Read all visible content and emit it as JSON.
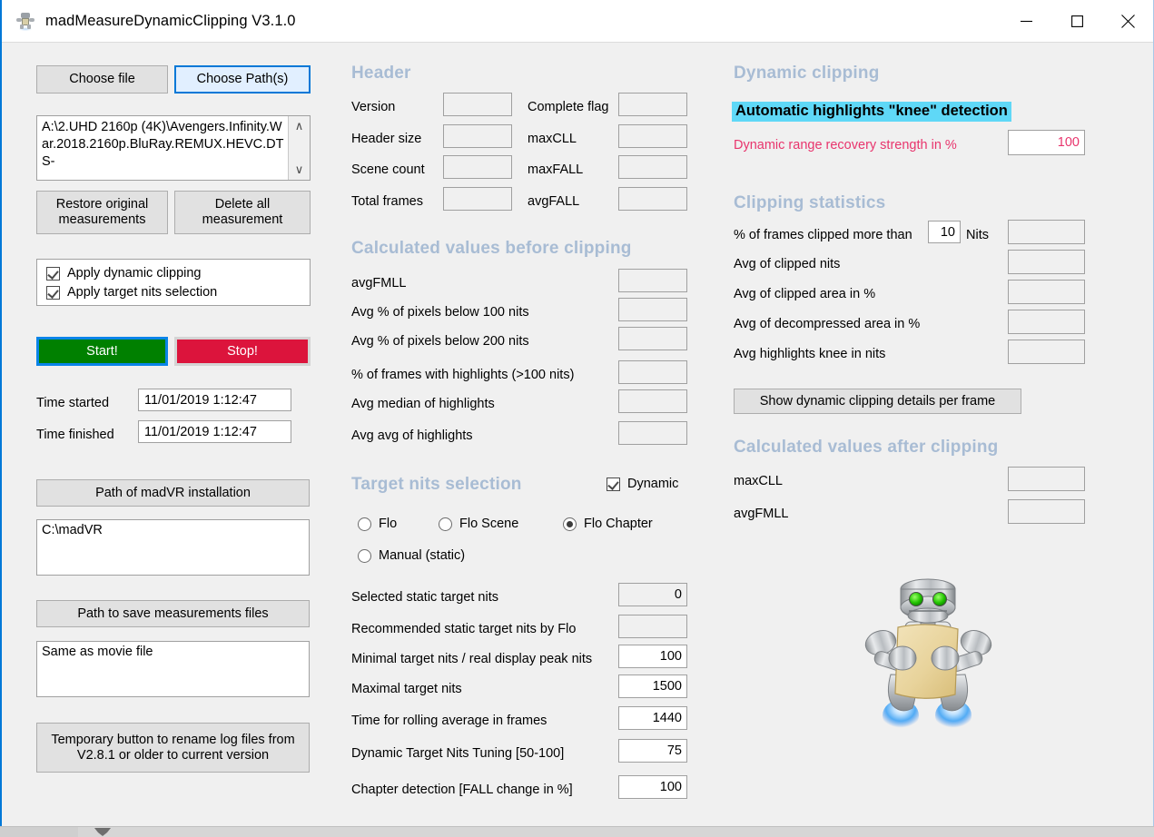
{
  "window": {
    "title": "madMeasureDynamicClipping V3.1.0",
    "icon": "robot-icon",
    "minimize_label": "minimize-icon",
    "maximize_label": "maximize-icon",
    "close_label": "close-icon"
  },
  "left": {
    "choose_file_button": "Choose file",
    "choose_paths_button": "Choose Path(s)",
    "file_path": "A:\\2.UHD 2160p (4K)\\Avengers.Infinity.War.2018.2160p.BluRay.REMUX.HEVC.DTS-",
    "scroll_up": "∧",
    "scroll_down": "∨",
    "restore_button": "Restore original measurements",
    "delete_button": "Delete all measurement",
    "checkboxes": [
      {
        "label": "Apply dynamic clipping",
        "checked": true
      },
      {
        "label": "Apply target nits selection",
        "checked": true
      }
    ],
    "start_button": "Start!",
    "stop_button": "Stop!",
    "time_started_label": "Time started",
    "time_started_value": "11/01/2019 1:12:47",
    "time_finished_label": "Time finished",
    "time_finished_value": "11/01/2019 1:12:47",
    "madvr_path_button": "Path of madVR installation",
    "madvr_path_value": "C:\\madVR",
    "save_path_button": "Path to save measurements files",
    "save_path_value": "Same as movie file",
    "rename_button": "Temporary button to rename log files from V2.8.1 or older to current version"
  },
  "header": {
    "section_title": "Header",
    "fields_left": [
      {
        "label": "Version",
        "value": ""
      },
      {
        "label": "Header size",
        "value": ""
      },
      {
        "label": "Scene count",
        "value": ""
      },
      {
        "label": "Total frames",
        "value": ""
      }
    ],
    "fields_right": [
      {
        "label": "Complete flag",
        "value": ""
      },
      {
        "label": "maxCLL",
        "value": ""
      },
      {
        "label": "maxFALL",
        "value": ""
      },
      {
        "label": "avgFALL",
        "value": ""
      }
    ]
  },
  "before_clipping": {
    "section_title": "Calculated values before clipping",
    "rows": [
      {
        "label": "avgFMLL",
        "value": ""
      },
      {
        "label": "Avg % of pixels below 100 nits",
        "value": ""
      },
      {
        "label": "Avg % of pixels below 200 nits",
        "value": ""
      },
      {
        "label": "% of frames with highlights (>100 nits)",
        "value": ""
      },
      {
        "label": "Avg median of highlights",
        "value": ""
      },
      {
        "label": "Avg avg of highlights",
        "value": ""
      }
    ]
  },
  "target_nits": {
    "section_title": "Target nits selection",
    "dynamic_checkbox": {
      "label": "Dynamic",
      "checked": true
    },
    "radios": [
      {
        "label": "Flo",
        "selected": false
      },
      {
        "label": "Flo Scene",
        "selected": false
      },
      {
        "label": "Flo Chapter",
        "selected": true
      },
      {
        "label": "Manual (static)",
        "selected": false
      }
    ],
    "rows": [
      {
        "label": "Selected static target nits",
        "value": "0",
        "editable": false
      },
      {
        "label": "Recommended static target nits by Flo",
        "value": "",
        "editable": false
      },
      {
        "label": "Minimal target nits / real display peak nits",
        "value": "100",
        "editable": true
      },
      {
        "label": "Maximal target nits",
        "value": "1500",
        "editable": true
      },
      {
        "label": "Time for rolling average in frames",
        "value": "1440",
        "editable": true
      },
      {
        "label": "Dynamic Target Nits Tuning [50-100]",
        "value": "75",
        "editable": true
      },
      {
        "label": "Chapter detection [FALL change in %]",
        "value": "100",
        "editable": true
      }
    ]
  },
  "dynamic_clipping": {
    "section_title": "Dynamic clipping",
    "knee_banner": "Automatic highlights \"knee\" detection",
    "strength_label": "Dynamic range recovery strength in %",
    "strength_value": "100"
  },
  "clipping_stats": {
    "section_title": "Clipping statistics",
    "frames_clipped_label_a": "% of frames clipped more than",
    "frames_clipped_threshold": "10",
    "frames_clipped_label_b": "Nits",
    "frames_clipped_value": "",
    "rows": [
      {
        "label": "Avg of clipped nits",
        "value": ""
      },
      {
        "label": "Avg of clipped area in %",
        "value": ""
      },
      {
        "label": "Avg of decompressed area in %",
        "value": ""
      },
      {
        "label": "Avg highlights knee in nits",
        "value": ""
      }
    ],
    "details_button": "Show dynamic clipping details per frame"
  },
  "after_clipping": {
    "section_title": "Calculated values after clipping",
    "rows": [
      {
        "label": "maxCLL",
        "value": ""
      },
      {
        "label": "avgFMLL",
        "value": ""
      }
    ]
  },
  "colors": {
    "accent_blue": "#0078d7",
    "section_heading": "#a8bcd4",
    "start_green": "#008000",
    "stop_crimson": "#dc143c",
    "knee_highlight": "#5fd8f7",
    "red_label": "#e8356d",
    "client_bg": "#f0f0f0"
  }
}
